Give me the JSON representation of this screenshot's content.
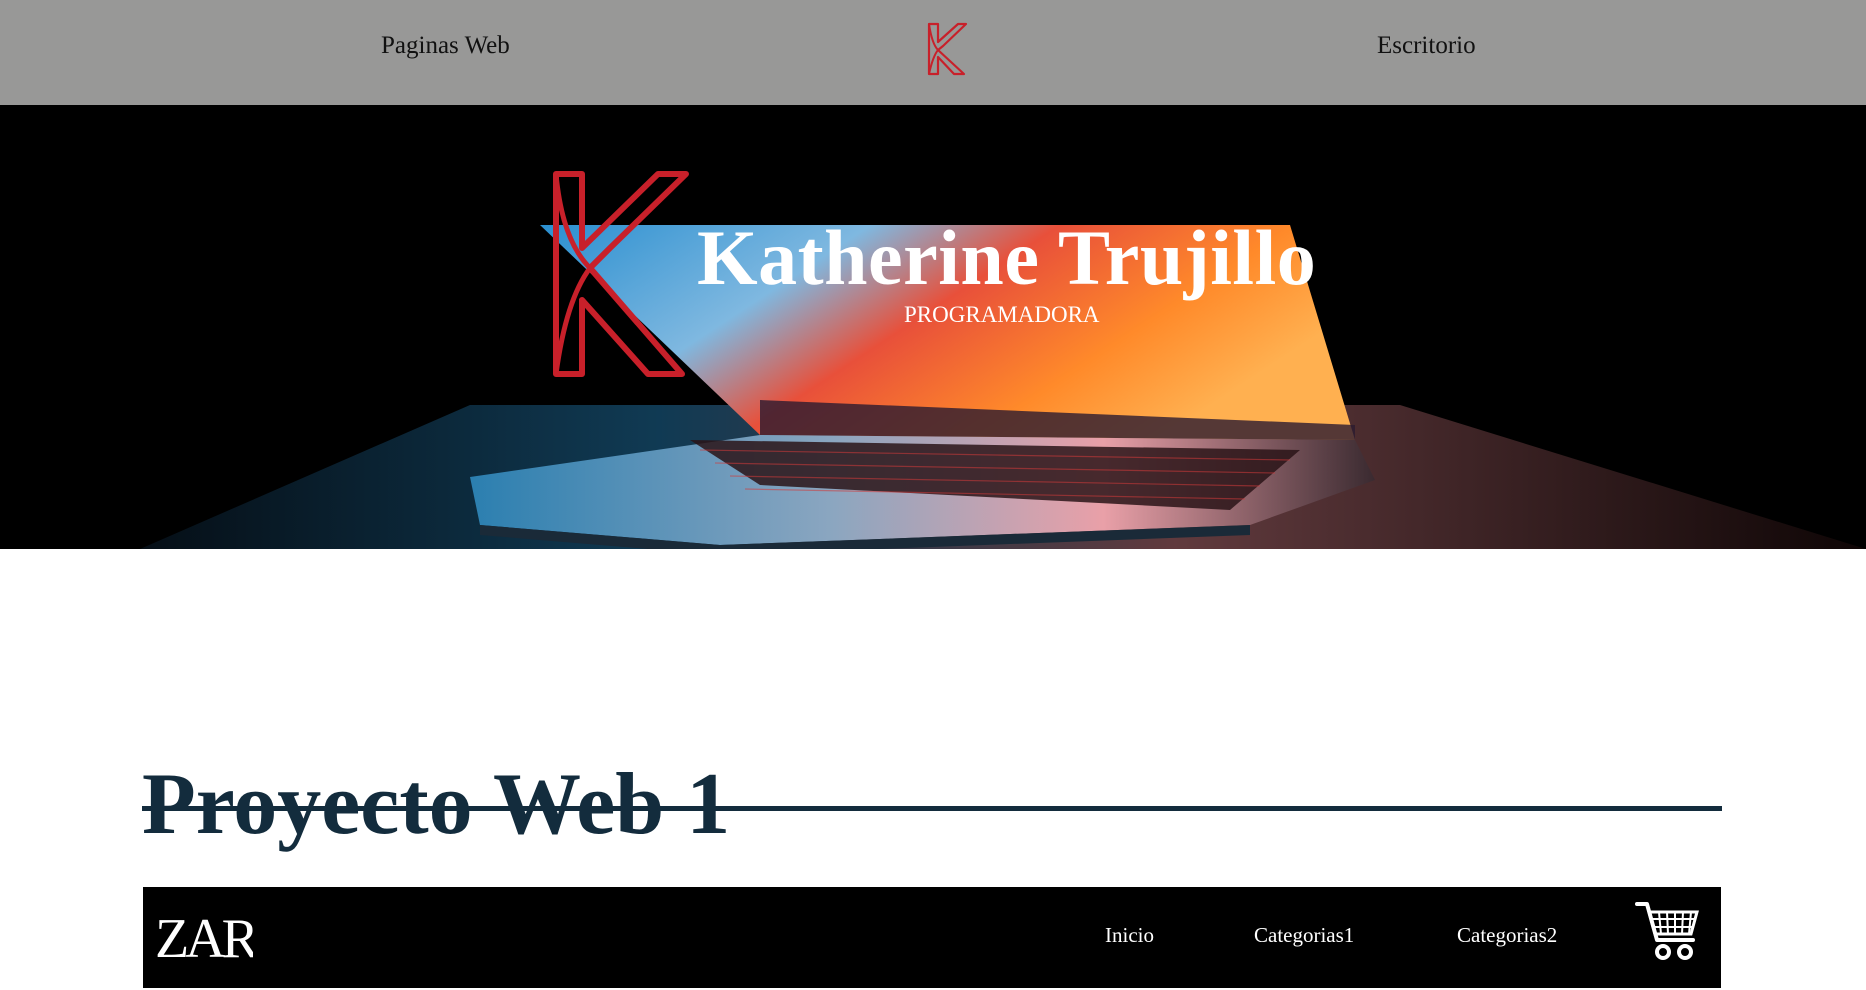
{
  "nav": {
    "left_label": "Paginas Web",
    "right_label": "Escritorio",
    "logo_icon": "k-logo-icon"
  },
  "hero": {
    "name": "Katherine Trujillo",
    "subtitle": "PROGRAMADORA",
    "logo_icon": "k-logo-icon",
    "background": "laptop-photo"
  },
  "project": {
    "title": "Proyecto Web 1",
    "preview": {
      "brand": "ZARA",
      "links": [
        "Inicio",
        "Categorias1",
        "Categorias2"
      ],
      "cart_icon": "shopping-cart-icon"
    }
  },
  "colors": {
    "nav_bg": "#989897",
    "accent_red": "#c8202a",
    "title_navy": "#132c3d",
    "hero_bg": "#000000"
  }
}
